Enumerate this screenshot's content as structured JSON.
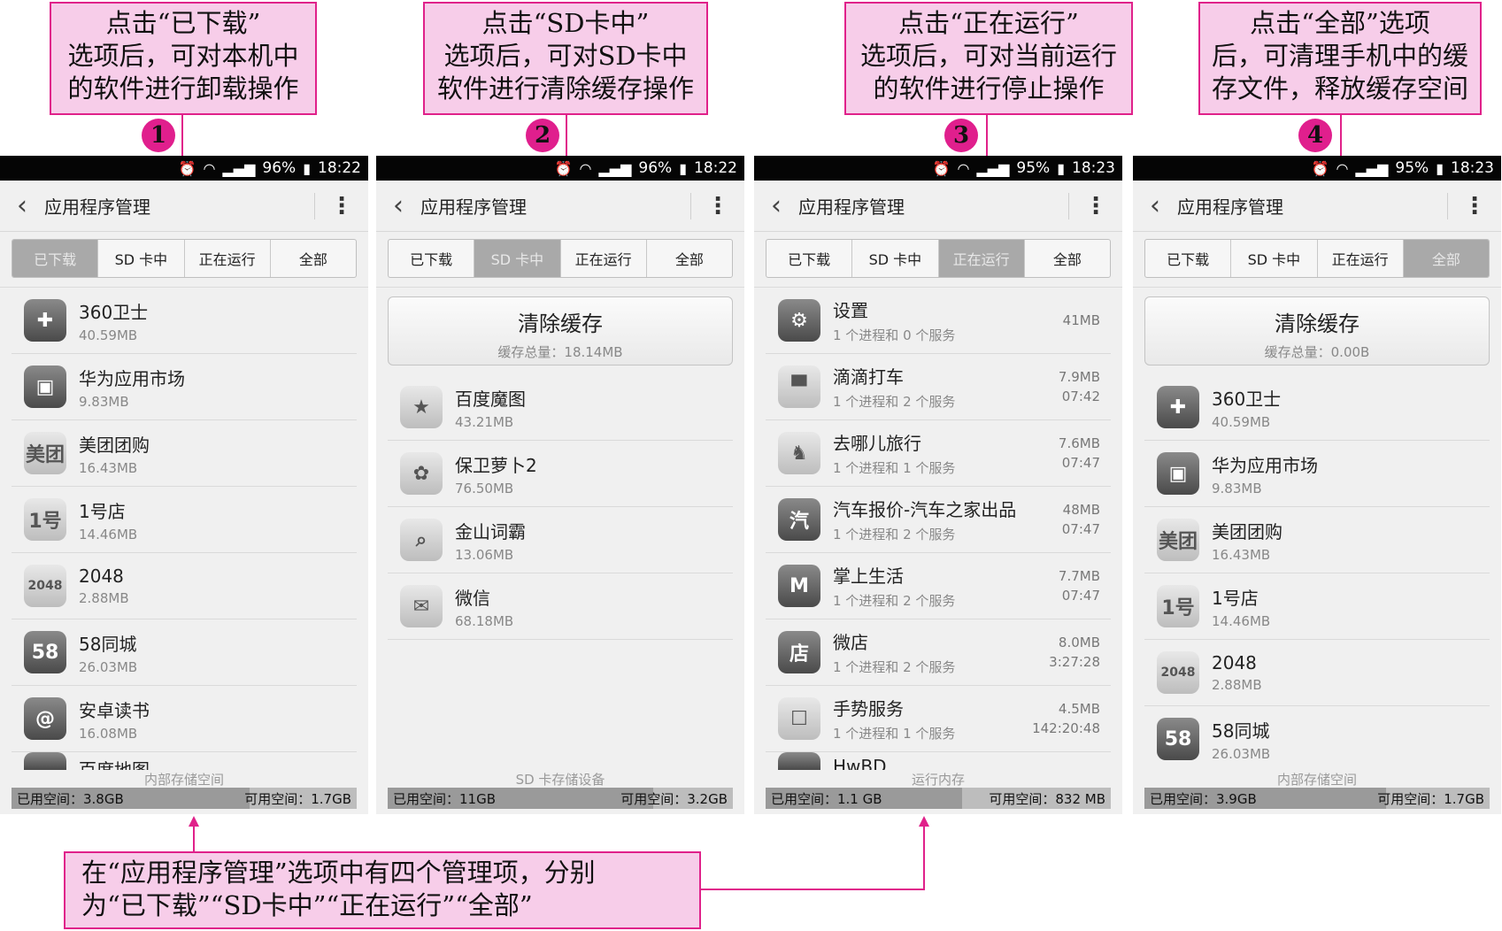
{
  "callouts": {
    "c1": "点击“已下载”\n选项后，可对本机中\n的软件进行卸载操作",
    "c2": "点击“SD卡中”\n选项后，可对SD卡中\n软件进行清除缓存操作",
    "c3": "点击“正在运行”\n选项后，可对当前运行\n的软件进行停止操作",
    "c4": "点击“全部”选项\n后，可清理手机中的缓\n存文件，释放缓存空间",
    "bottom": "在“应用程序管理”选项中有四个管理项，分别\n为“已下载”“SD卡中”“正在运行”“全部”"
  },
  "badges": [
    "1",
    "2",
    "3",
    "4"
  ],
  "app_title": "应用程序管理",
  "tabs": [
    "已下载",
    "SD 卡中",
    "正在运行",
    "全部"
  ],
  "phones": [
    {
      "status": {
        "battery": "96%",
        "time": "18:22"
      },
      "active_tab": 0,
      "apps": [
        {
          "name": "360卫士",
          "size": "40.59MB",
          "icon": "360-icon"
        },
        {
          "name": "华为应用市场",
          "size": "9.83MB",
          "icon": "appmarket-icon"
        },
        {
          "name": "美团团购",
          "size": "16.43MB",
          "icon": "meituan-icon"
        },
        {
          "name": "1号店",
          "size": "14.46MB",
          "icon": "yhd-icon"
        },
        {
          "name": "2048",
          "size": "2.88MB",
          "icon": "2048-icon"
        },
        {
          "name": "58同城",
          "size": "26.03MB",
          "icon": "58-icon"
        },
        {
          "name": "安卓读书",
          "size": "16.08MB",
          "icon": "book-icon"
        }
      ],
      "cut_item": "百度地图",
      "footer": {
        "label": "内部存储空间",
        "used": "已用空间：3.8GB",
        "free": "可用空间：1.7GB",
        "used_fraction": 0.69
      }
    },
    {
      "status": {
        "battery": "96%",
        "time": "18:22"
      },
      "active_tab": 1,
      "clear": {
        "title": "清除缓存",
        "sub": "缓存总量：18.14MB"
      },
      "apps": [
        {
          "name": "百度魔图",
          "size": "43.21MB",
          "icon": "wand-icon"
        },
        {
          "name": "保卫萝卜2",
          "size": "76.50MB",
          "icon": "radish-icon"
        },
        {
          "name": "金山词霸",
          "size": "13.06MB",
          "icon": "magnifier-icon"
        },
        {
          "name": "微信",
          "size": "68.18MB",
          "icon": "wechat-icon"
        }
      ],
      "footer": {
        "label": "SD 卡存储设备",
        "used": "已用空间：11GB",
        "free": "可用空间：3.2GB",
        "used_fraction": 0.77
      }
    },
    {
      "status": {
        "battery": "95%",
        "time": "18:23"
      },
      "active_tab": 2,
      "apps": [
        {
          "name": "设置",
          "size": "1 个进程和 0 个服务",
          "mem": "41MB",
          "time": "",
          "icon": "settings-icon"
        },
        {
          "name": "滴滴打车",
          "size": "1 个进程和 2 个服务",
          "mem": "7.9MB",
          "time": "07:42",
          "icon": "taxi-icon"
        },
        {
          "name": "去哪儿旅行",
          "size": "1 个进程和 1 个服务",
          "mem": "7.6MB",
          "time": "07:47",
          "icon": "camel-icon"
        },
        {
          "name": "汽车报价-汽车之家出品",
          "size": "1 个进程和 2 个服务",
          "mem": "48MB",
          "time": "07:47",
          "icon": "car-price-icon"
        },
        {
          "name": "掌上生活",
          "size": "1 个进程和 2 个服务",
          "mem": "7.7MB",
          "time": "07:47",
          "icon": "cmb-icon"
        },
        {
          "name": "微店",
          "size": "1 个进程和 2 个服务",
          "mem": "8.0MB",
          "time": "3:27:28",
          "icon": "store-icon"
        },
        {
          "name": "手势服务",
          "size": "1 个进程和 1 个服务",
          "mem": "4.5MB",
          "time": "142:20:48",
          "icon": "gesture-icon"
        }
      ],
      "cut_item": "HwBD",
      "footer": {
        "label": "运行内存",
        "used": "已用空间：1.1 GB",
        "free": "可用空间：832 MB",
        "used_fraction": 0.57
      }
    },
    {
      "status": {
        "battery": "95%",
        "time": "18:23"
      },
      "active_tab": 3,
      "clear": {
        "title": "清除缓存",
        "sub": "缓存总量：0.00B"
      },
      "apps": [
        {
          "name": "360卫士",
          "size": "40.59MB",
          "icon": "360-icon"
        },
        {
          "name": "华为应用市场",
          "size": "9.83MB",
          "icon": "appmarket-icon"
        },
        {
          "name": "美团团购",
          "size": "16.43MB",
          "icon": "meituan-icon"
        },
        {
          "name": "1号店",
          "size": "14.46MB",
          "icon": "yhd-icon"
        },
        {
          "name": "2048",
          "size": "2.88MB",
          "icon": "2048-icon"
        },
        {
          "name": "58同城",
          "size": "26.03MB",
          "icon": "58-icon"
        }
      ],
      "footer": {
        "label": "内部存储空间",
        "used": "已用空间：3.9GB",
        "free": "可用空间：1.7GB",
        "used_fraction": 0.7
      }
    }
  ],
  "colors": {
    "callout_bg": "#f7cde9",
    "callout_border": "#e0218a",
    "badge": "#e01f8d",
    "active_tab": "#a9a9a9"
  }
}
